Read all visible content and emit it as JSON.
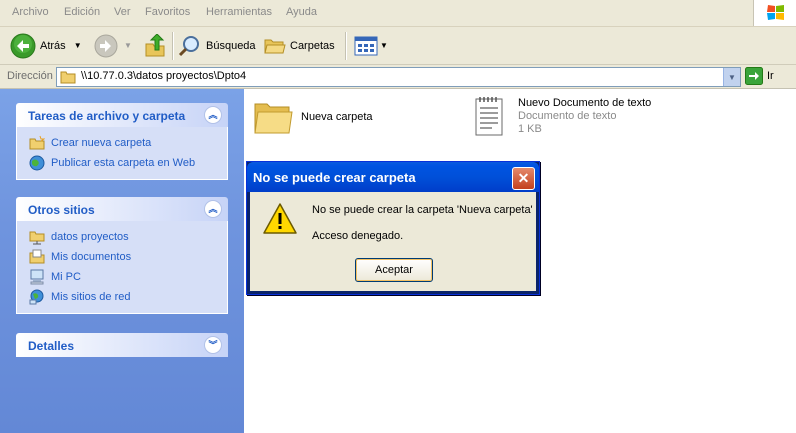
{
  "menu": [
    "Archivo",
    "Edición",
    "Ver",
    "Favoritos",
    "Herramientas",
    "Ayuda"
  ],
  "toolbar": {
    "back_label": "Atrás",
    "search_label": "Búsqueda",
    "folders_label": "Carpetas"
  },
  "address": {
    "label": "Dirección",
    "path": "\\\\10.77.0.3\\datos proyectos\\Dpto4",
    "go_label": "Ir"
  },
  "taskpane": {
    "file_tasks": {
      "title": "Tareas de archivo y carpeta",
      "items": [
        "Crear nueva carpeta",
        "Publicar esta carpeta en Web"
      ]
    },
    "other_places": {
      "title": "Otros sitios",
      "items": [
        "datos proyectos",
        "Mis documentos",
        "Mi PC",
        "Mis sitios de red"
      ]
    },
    "details": {
      "title": "Detalles"
    }
  },
  "files": [
    {
      "name": "Nueva carpeta",
      "icon": "folder-icon"
    },
    {
      "name": "Nuevo Documento de texto",
      "type": "Documento de texto",
      "size": "1 KB",
      "icon": "text-document-icon"
    }
  ],
  "dialog": {
    "title": "No se puede crear carpeta",
    "message": "No se puede crear la carpeta 'Nueva carpeta'",
    "detail": "Acceso denegado.",
    "ok_label": "Aceptar",
    "icon": "warning-icon"
  },
  "colors": {
    "taskpane_blue": "#6f94de",
    "link_blue": "#215dc6",
    "title_bar": "#0050d9"
  }
}
